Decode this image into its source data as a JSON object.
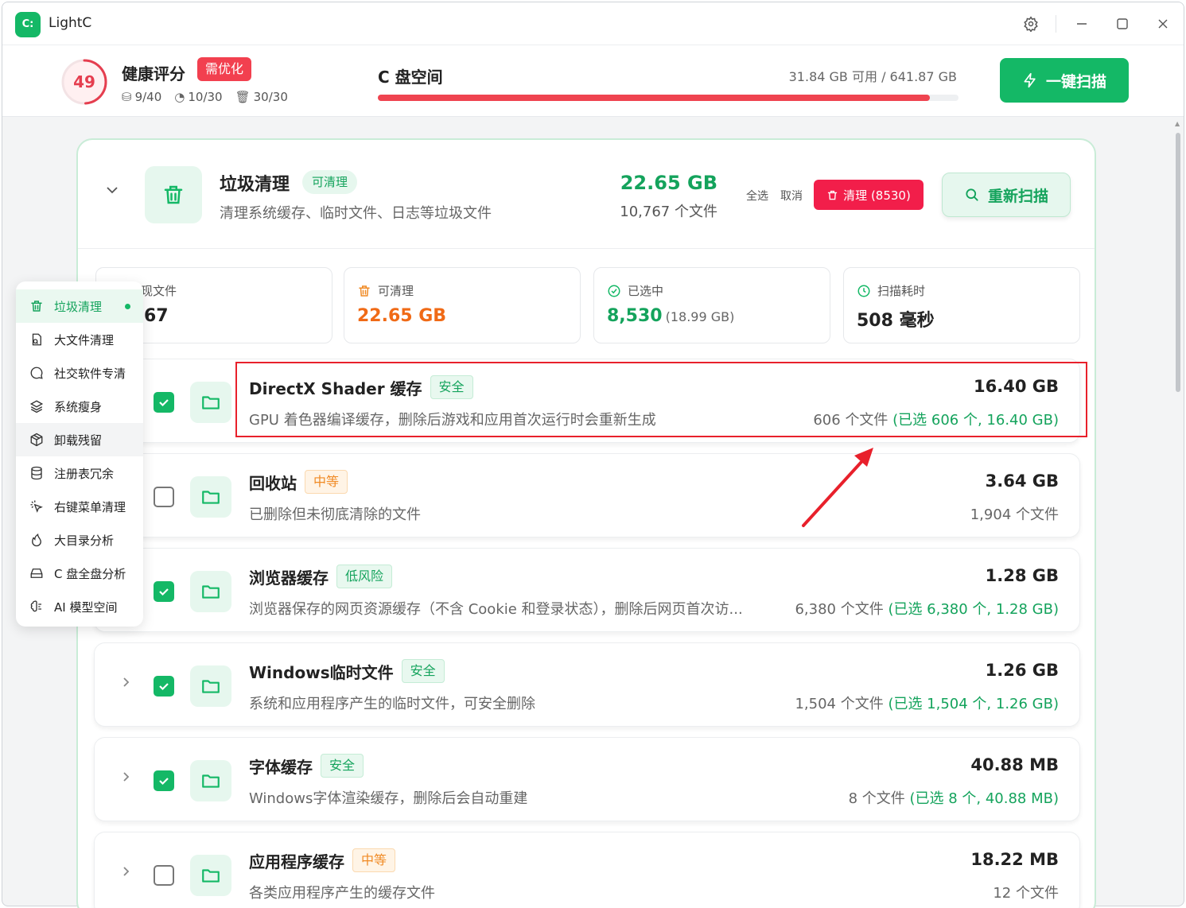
{
  "app": {
    "logo": "C:",
    "title": "LightC"
  },
  "titlebar": {
    "settings_icon": "gear-icon",
    "minimize_icon": "minimize-icon",
    "maximize_icon": "maximize-icon",
    "close_icon": "close-icon"
  },
  "health": {
    "score": "49",
    "score_fraction": 0.49,
    "title": "健康评分",
    "badge": "需优化",
    "stats": [
      "9/40",
      "10/30",
      "30/30"
    ]
  },
  "disk": {
    "title": "C 盘空间",
    "info": "31.84 GB 可用 / 641.87 GB",
    "used_fraction": 0.95
  },
  "scan_button": "一键扫描",
  "category": {
    "title": "垃圾清理",
    "badge": "可清理",
    "desc": "清理系统缓存、临时文件、日志等垃圾文件",
    "size": "22.65 GB",
    "files": "10,767 个文件",
    "select_all": "全选",
    "cancel": "取消",
    "clean_button": "清理 (8530)",
    "rescan_button": "重新扫描"
  },
  "stats": [
    {
      "label": "发现文件",
      "value": "10,767",
      "sub": ""
    },
    {
      "label": "可清理",
      "value": "22.65 GB",
      "sub": ""
    },
    {
      "label": "已选中",
      "value": "8,530",
      "sub": "(18.99 GB)"
    },
    {
      "label": "扫描耗时",
      "value": "508 毫秒",
      "sub": ""
    }
  ],
  "stats_visible": [
    "现文件",
    "67"
  ],
  "items": [
    {
      "title": "DirectX Shader 缓存",
      "risk": "安全",
      "desc": "GPU 着色器编译缓存，删除后游戏和应用首次运行时会重新生成",
      "size": "16.40 GB",
      "files": "606 个文件",
      "selected": " (已选 606 个, 16.40 GB)",
      "checked": true
    },
    {
      "title": "回收站",
      "risk": "中等",
      "desc": "已删除但未彻底清除的文件",
      "size": "3.64 GB",
      "files": "1,904 个文件",
      "selected": "",
      "checked": false
    },
    {
      "title": "浏览器缓存",
      "risk": "低风险",
      "desc": "浏览器保存的网页资源缓存（不含 Cookie 和登录状态），删除后网页首次访...",
      "size": "1.28 GB",
      "files": "6,380 个文件",
      "selected": " (已选 6,380 个, 1.28 GB)",
      "checked": true
    },
    {
      "title": "Windows临时文件",
      "risk": "安全",
      "desc": "系统和应用程序产生的临时文件，可安全删除",
      "size": "1.26 GB",
      "files": "1,504 个文件",
      "selected": " (已选 1,504 个, 1.26 GB)",
      "checked": true
    },
    {
      "title": "字体缓存",
      "risk": "安全",
      "desc": "Windows字体渲染缓存，删除后会自动重建",
      "size": "40.88 MB",
      "files": "8 个文件",
      "selected": " (已选 8 个, 40.88 MB)",
      "checked": true
    },
    {
      "title": "应用程序缓存",
      "risk": "中等",
      "desc": "各类应用程序产生的缓存文件",
      "size": "18.22 MB",
      "files": "12 个文件",
      "selected": "",
      "checked": false
    }
  ],
  "menu": [
    {
      "label": "垃圾清理",
      "icon": "trash-icon"
    },
    {
      "label": "大文件清理",
      "icon": "big-file-icon"
    },
    {
      "label": "社交软件专清",
      "icon": "chat-icon"
    },
    {
      "label": "系统瘦身",
      "icon": "layers-icon"
    },
    {
      "label": "卸载残留",
      "icon": "package-icon"
    },
    {
      "label": "注册表冗余",
      "icon": "database-icon"
    },
    {
      "label": "右键菜单清理",
      "icon": "cursor-click-icon"
    },
    {
      "label": "大目录分析",
      "icon": "flame-icon"
    },
    {
      "label": "C 盘全盘分析",
      "icon": "hard-drive-icon"
    },
    {
      "label": "AI 模型空间",
      "icon": "ai-brain-icon"
    }
  ],
  "colors": {
    "accent": "#14b866",
    "danger": "#f21e4a",
    "warning": "#f08a24"
  }
}
